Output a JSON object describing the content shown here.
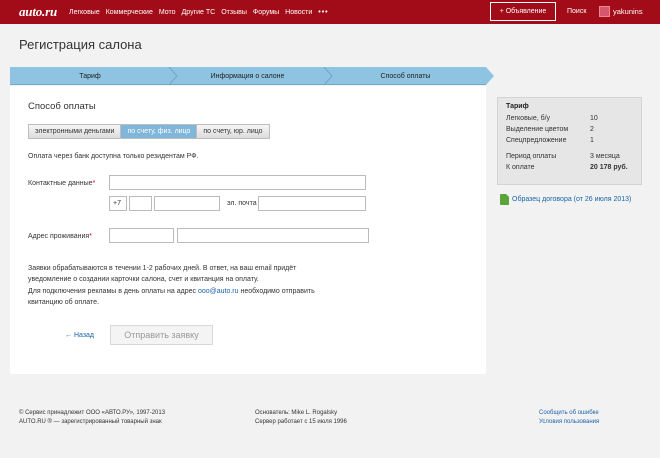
{
  "header": {
    "logo": "auto.ru",
    "nav": [
      "Легковые",
      "Коммерческие",
      "Мото",
      "Другие ТС",
      "Отзывы",
      "Форумы",
      "Новости"
    ],
    "more": "•••",
    "ad_button": "+ Объявление",
    "search": "Поиск",
    "user": "yakunins"
  },
  "page_title": "Регистрация салона",
  "steps": [
    "Тариф",
    "Информация о салоне",
    "Способ оплаты"
  ],
  "form": {
    "section_title": "Способ оплаты",
    "tabs": [
      "электронными деньгами",
      "по счету, физ. лицо",
      "по счету, юр. лицо"
    ],
    "note": "Оплата через банк доступна только резидентам РФ.",
    "contact_label": "Контактные данные",
    "required_mark": "*",
    "phone_prefix": "+7",
    "email_label": "эл. почта",
    "address_label": "Адрес проживания",
    "info_text": "Заявки обрабатываются в течении 1-2 рабочих дней. В ответ, на ваш email придёт уведомление о создании карточки салона, счет и квитанция на оплату.",
    "advert_text_1": "Для подключения рекламы в день оплаты на адрес ",
    "advert_email": "ooo@auto.ru",
    "advert_text_2": " необходимо отправить квитанцию об оплате.",
    "back": "← Назад",
    "submit": "Отправить заявку"
  },
  "tariff": {
    "title": "Тариф",
    "rows": [
      {
        "label": "Легковые, б/у",
        "value": "10"
      },
      {
        "label": "Выделение цветом",
        "value": "2"
      },
      {
        "label": "Спецпредложение",
        "value": "1"
      },
      {
        "label": "Период оплаты",
        "value": "3 месяца"
      },
      {
        "label": "К оплате",
        "value": "20 178 руб."
      }
    ]
  },
  "contract_link": "Образец договора (от 26 июля 2013)",
  "footer": {
    "copyright": "© Сервис принадлежит ООО «АВТО.РУ», 1997-2013",
    "trademark": "AUTO.RU ® — зарегистрированный товарный знак",
    "founder": "Основатель: Mike L. Rogalsky",
    "server": "Сервер работает с 15 июля 1996",
    "report_error": "Сообщить об ошибке",
    "terms": "Условия пользования"
  },
  "colors": {
    "header_bg": "#a20c18",
    "steps_bg": "#8ec4e2",
    "active_tab": "#7fb6d9",
    "link": "#1a63a8"
  }
}
